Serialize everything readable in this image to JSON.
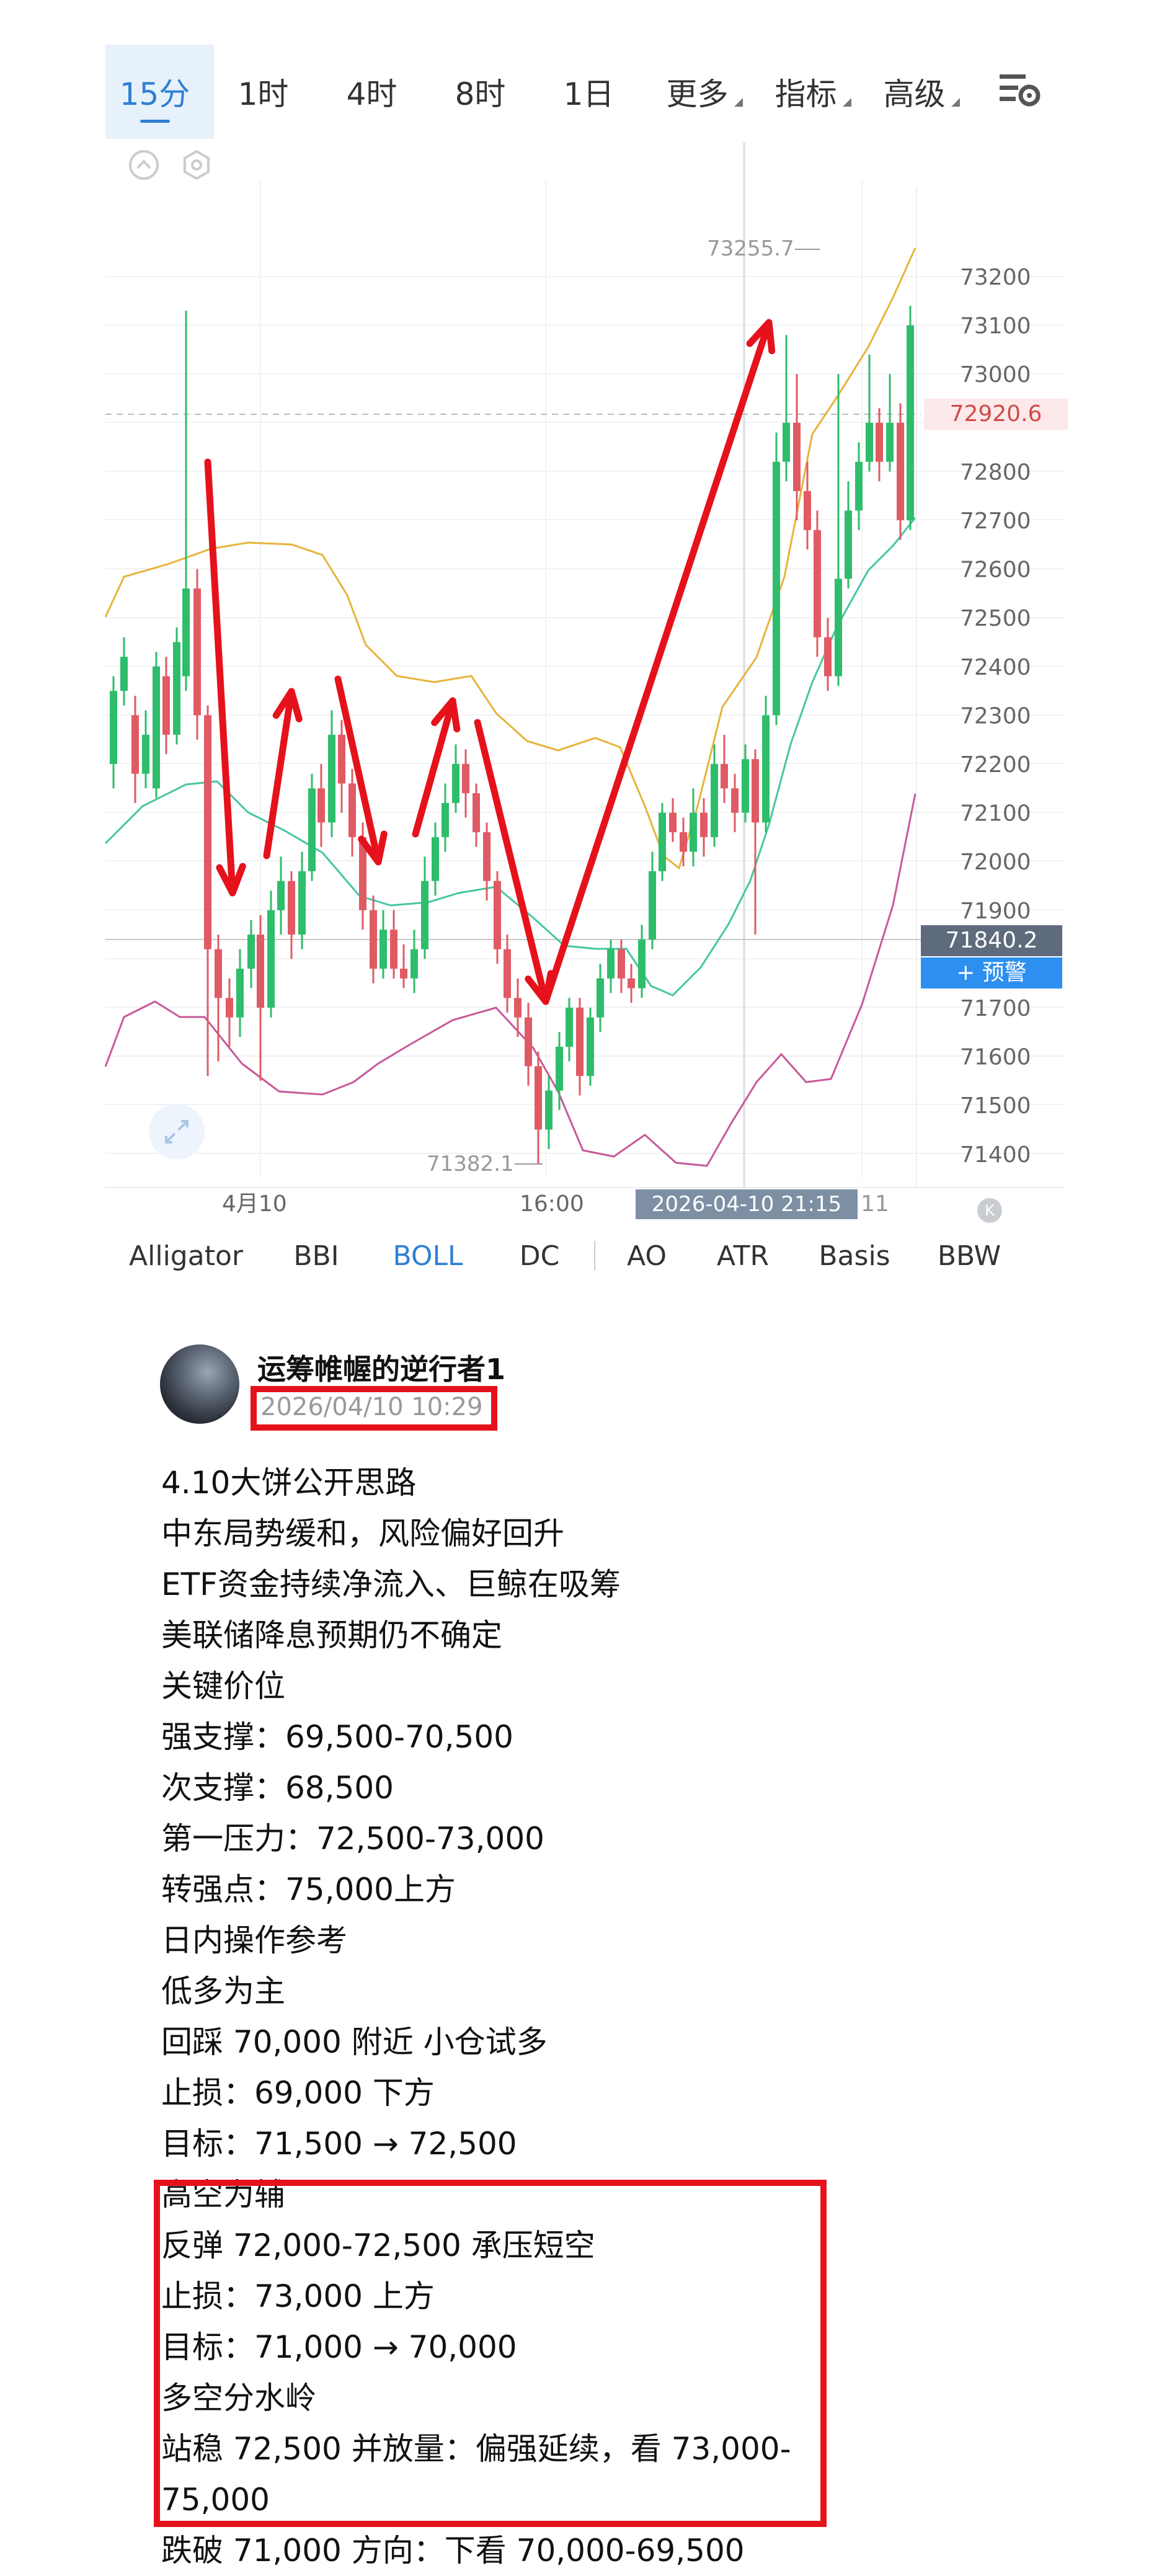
{
  "tabs": [
    {
      "label": "15分",
      "active": true,
      "dropdown": false
    },
    {
      "label": "1时",
      "active": false,
      "dropdown": false
    },
    {
      "label": "4时",
      "active": false,
      "dropdown": false
    },
    {
      "label": "8时",
      "active": false,
      "dropdown": false
    },
    {
      "label": "1日",
      "active": false,
      "dropdown": false
    },
    {
      "label": "更多",
      "active": false,
      "dropdown": true
    },
    {
      "label": "指标",
      "active": false,
      "dropdown": true
    },
    {
      "label": "高级",
      "active": false,
      "dropdown": true
    }
  ],
  "icons": {
    "settings": "chart-settings-icon",
    "collapse": "collapse-up-icon",
    "hexagon": "hexagon-settings-icon",
    "expand": "expand-icon",
    "scroll_end": "scroll-to-end-icon"
  },
  "chart": {
    "price_labels": [
      "73200",
      "73100",
      "73000",
      "72800",
      "72700",
      "72600",
      "72500",
      "72400",
      "72300",
      "72200",
      "72100",
      "72000",
      "71900",
      "71700",
      "71600",
      "71500",
      "71400"
    ],
    "current_price": "72920.6",
    "last_price": "71840.2",
    "high_label": "73255.7",
    "low_label": "71382.1",
    "time_labels": [
      "4月10",
      "16:00"
    ],
    "crosshair_time": "2026-04-10 21:15",
    "partial_time": "11",
    "alert_button": "+ 预警",
    "colors": {
      "up": "#2ebd6b",
      "down": "#e05a64",
      "boll_upper": "#e7b33b",
      "boll_mid": "#45c6a2",
      "boll_lower": "#c8589a",
      "arrow": "#e5121c"
    }
  },
  "indicators": [
    {
      "label": "Alligator",
      "active": false
    },
    {
      "label": "BBI",
      "active": false
    },
    {
      "label": "BOLL",
      "active": true
    },
    {
      "label": "DC",
      "active": false
    },
    {
      "label": "AO",
      "active": false
    },
    {
      "label": "ATR",
      "active": false
    },
    {
      "label": "Basis",
      "active": false
    },
    {
      "label": "BBW",
      "active": false
    }
  ],
  "post": {
    "author": "运筹帷幄的逆行者1",
    "date": "2026/04/10 10:29",
    "lines": [
      "4.10大饼公开思路",
      "中东局势缓和，风险偏好回升",
      "ETF资金持续净流入、巨鲸在吸筹",
      "美联储降息预期仍不确定",
      "关键价位",
      "强支撑：69,500-70,500",
      "次支撑：68,500",
      "第一压力：72,500-73,000",
      "转强点：75,000上方",
      "日内操作参考",
      "低多为主",
      "回踩 70,000 附近 小仓试多",
      "止损：69,000 下方",
      "目标：71,500 → 72,500",
      "高空为辅",
      "反弹 72,000-72,500 承压短空",
      "止损：73,000 上方",
      "目标：71,000 → 70,000",
      "多空分水岭",
      "站稳 72,500 并放量：偏强延续，看 73,000-",
      "75,000",
      "跌破 71,000 方向：下看 70,000-69,500"
    ]
  }
}
